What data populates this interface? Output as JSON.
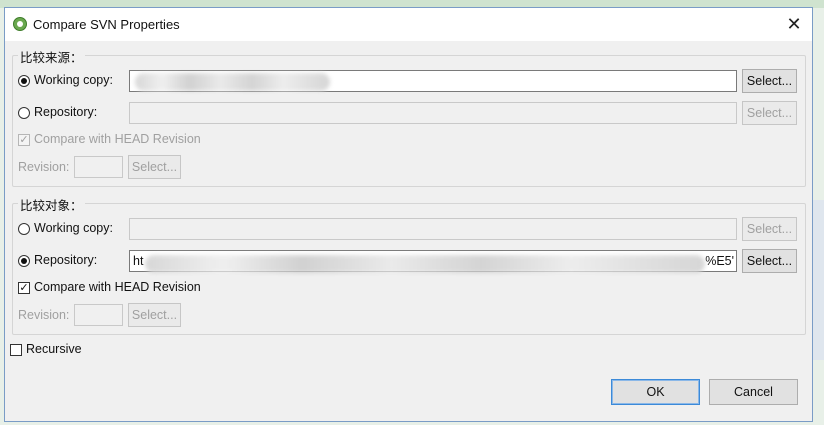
{
  "window": {
    "title": "Compare SVN Properties",
    "close_glyph": "✕"
  },
  "source_group": {
    "label": "比较来源：",
    "working_copy_label": "Working copy:",
    "working_copy_value": "",
    "repository_label": "Repository:",
    "repository_value": "",
    "compare_head_label": "Compare with HEAD Revision",
    "revision_label": "Revision:",
    "revision_value": "",
    "select_label": "Select...",
    "selected": "working_copy",
    "compare_head_checked": true
  },
  "target_group": {
    "label": "比较对象：",
    "working_copy_label": "Working copy:",
    "working_copy_value": "",
    "repository_label": "Repository:",
    "repository_value_prefix": "ht",
    "repository_value_suffix": "%E5'",
    "compare_head_label": "Compare with HEAD Revision",
    "revision_label": "Revision:",
    "revision_value": "",
    "select_label": "Select...",
    "selected": "repository",
    "compare_head_checked": true
  },
  "recursive": {
    "label": "Recursive",
    "checked": false
  },
  "buttons": {
    "ok": "OK",
    "cancel": "Cancel"
  },
  "check_glyph": "✓"
}
